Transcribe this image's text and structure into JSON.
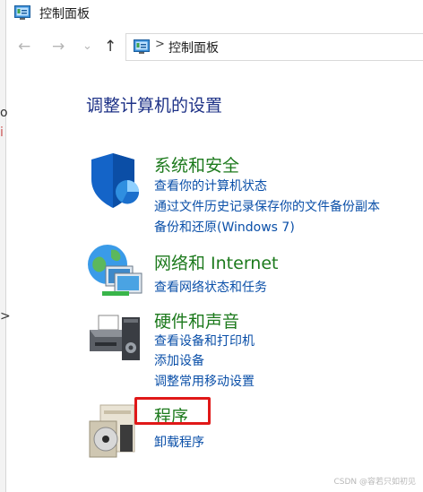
{
  "window": {
    "title": "控制面板"
  },
  "nav": {
    "back_glyph": "←",
    "forward_glyph": "→",
    "recent_glyph": "⌄",
    "up_glyph": "↑"
  },
  "address": {
    "separator": ">",
    "crumb": "控制面板"
  },
  "heading": "调整计算机的设置",
  "categories": [
    {
      "title": "系统和安全",
      "icon": "shield-icon",
      "links": [
        "查看你的计算机状态",
        "通过文件历史记录保存你的文件备份副本",
        "备份和还原(Windows 7)"
      ]
    },
    {
      "title": "网络和 Internet",
      "icon": "network-globe-icon",
      "links": [
        "查看网络状态和任务"
      ]
    },
    {
      "title": "硬件和声音",
      "icon": "printer-icon",
      "links": [
        "查看设备和打印机",
        "添加设备",
        "调整常用移动设置"
      ]
    },
    {
      "title": "程序",
      "icon": "programs-disc-icon",
      "links": [
        "卸载程序"
      ]
    }
  ],
  "watermark": "CSDN @容若只如初见",
  "colors": {
    "heading": "#1e3287",
    "category_title": "#1d7a1d",
    "link": "#0a4fa8",
    "highlight_box": "#e01818"
  }
}
